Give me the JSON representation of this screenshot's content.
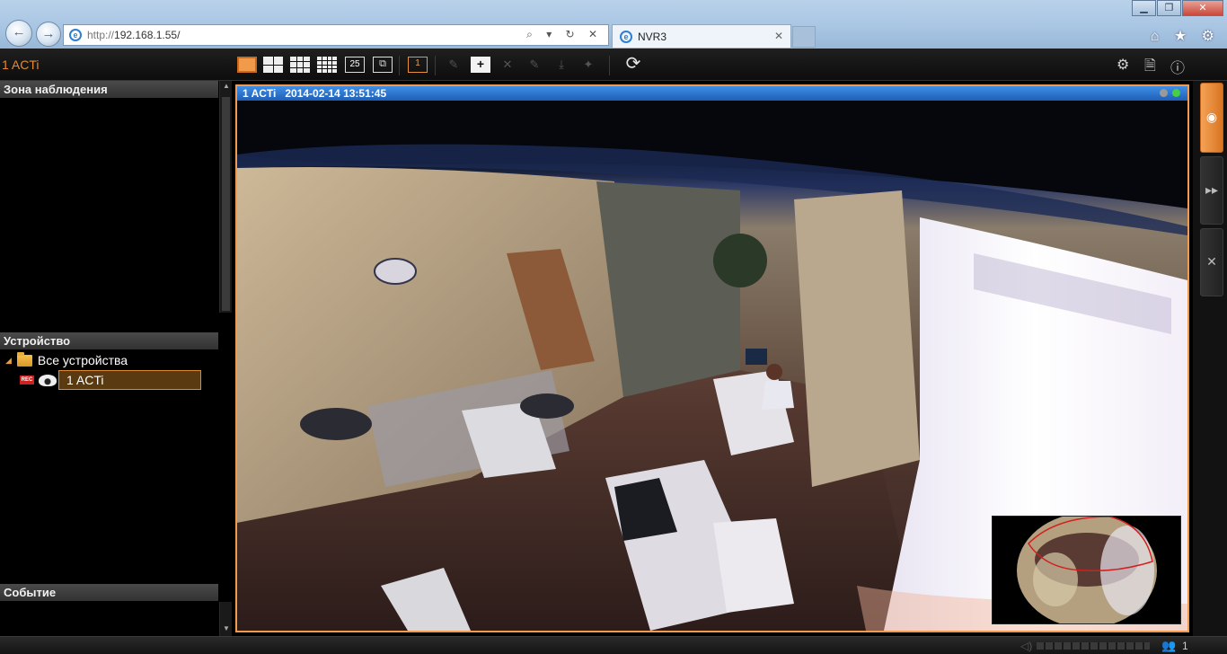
{
  "browser": {
    "url_prefix": "http://",
    "url_host": "192.168.1.55/",
    "tab_title": "NVR3",
    "address_tools": "⌕ ▾ ↻ ✕",
    "right_icons": "⌂ ★ ⚙",
    "window_controls": {
      "minimize": "▁",
      "maximize": "❐",
      "close": "✕"
    }
  },
  "app": {
    "title": "1 ACTi",
    "toolbar": {
      "layout_25_label": "25",
      "single_view_label": "1",
      "refresh_label": "⟳",
      "settings_icon": "⚙",
      "document_icon": "🗎",
      "info_icon": "ⓘ"
    }
  },
  "left_panel": {
    "surveillance_header": "Зона наблюдения",
    "device_header": "Устройство",
    "all_devices": "Все устройства",
    "rec_badge": "REC",
    "device_name": "1 ACTi",
    "event_header": "Событие"
  },
  "video": {
    "camera_name": "1 ACTi",
    "timestamp": "2014-02-14 13:51:45"
  },
  "right_tabs": {
    "view_icon": "◉",
    "playback_icon": "▸▸",
    "setup_icon": "✕"
  },
  "status_bar": {
    "volume_icon": "◁)",
    "users_icon": "👥",
    "users_count": "1"
  },
  "colors": {
    "accent_orange": "#f29a4e",
    "title_blue": "#1e5fb6",
    "panel_header": "#3c3c3c",
    "status_green": "#44d040"
  }
}
